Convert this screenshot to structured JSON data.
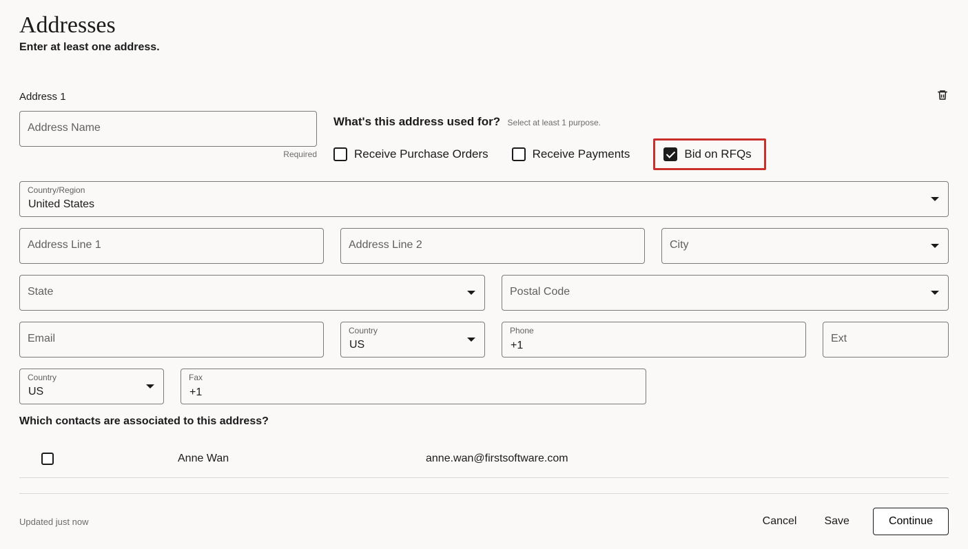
{
  "header": {
    "title": "Addresses",
    "subtitle": "Enter at least one address."
  },
  "address": {
    "section_label": "Address 1",
    "name_placeholder": "Address Name",
    "required_note": "Required",
    "purpose": {
      "question": "What's this address used for?",
      "hint": "Select at least 1 purpose.",
      "options": {
        "receive_po": {
          "label": "Receive Purchase Orders",
          "checked": false
        },
        "receive_pay": {
          "label": "Receive Payments",
          "checked": false
        },
        "bid_rfq": {
          "label": "Bid on RFQs",
          "checked": true
        }
      }
    },
    "country_region": {
      "label": "Country/Region",
      "value": "United States"
    },
    "line1_placeholder": "Address Line 1",
    "line2_placeholder": "Address Line 2",
    "city_placeholder": "City",
    "state_placeholder": "State",
    "postal_placeholder": "Postal Code",
    "email_placeholder": "Email",
    "phone_country": {
      "label": "Country",
      "value": "US"
    },
    "phone": {
      "label": "Phone",
      "value": "+1"
    },
    "ext_placeholder": "Ext",
    "fax_country": {
      "label": "Country",
      "value": "US"
    },
    "fax": {
      "label": "Fax",
      "value": "+1"
    }
  },
  "contacts": {
    "question": "Which contacts are associated to this address?",
    "rows": [
      {
        "name": "Anne Wan",
        "email": "anne.wan@firstsoftware.com",
        "checked": false
      }
    ]
  },
  "footer": {
    "status": "Updated just now",
    "cancel": "Cancel",
    "save": "Save",
    "continue": "Continue"
  }
}
